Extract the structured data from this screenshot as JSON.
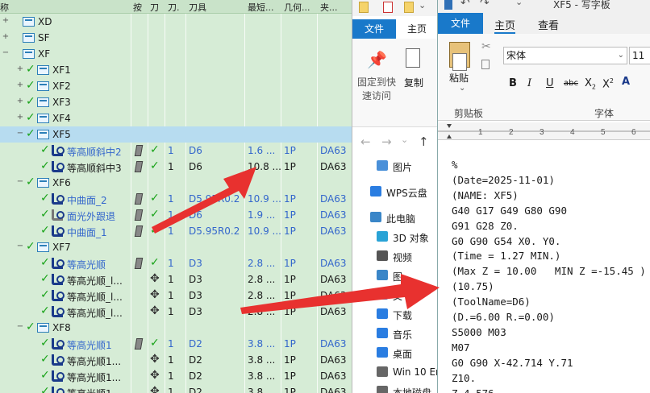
{
  "tree": {
    "columns": [
      "称",
      "按",
      "刀",
      "刀.",
      "刀具",
      "最短...",
      "几何...",
      "夹..."
    ],
    "rows": [
      {
        "level": 0,
        "expand": "+",
        "check": false,
        "icon": "folder",
        "label": "XD",
        "blue": false,
        "cells": []
      },
      {
        "level": 0,
        "expand": "+",
        "check": false,
        "icon": "folder",
        "label": "SF",
        "blue": false,
        "cells": []
      },
      {
        "level": 0,
        "expand": "−",
        "check": false,
        "icon": "folder",
        "label": "XF",
        "blue": false,
        "cells": []
      },
      {
        "level": 1,
        "expand": "+",
        "check": true,
        "icon": "folder",
        "label": "XF1",
        "blue": false,
        "cells": []
      },
      {
        "level": 1,
        "expand": "+",
        "check": true,
        "icon": "folder",
        "label": "XF2",
        "blue": false,
        "cells": []
      },
      {
        "level": 1,
        "expand": "+",
        "check": true,
        "icon": "folder",
        "label": "XF3",
        "blue": false,
        "cells": []
      },
      {
        "level": 1,
        "expand": "+",
        "check": true,
        "icon": "folder",
        "label": "XF4",
        "blue": false,
        "cells": []
      },
      {
        "level": 1,
        "expand": "−",
        "check": true,
        "icon": "folder",
        "label": "XF5",
        "blue": false,
        "selected": true,
        "cells": []
      },
      {
        "level": 2,
        "expand": "",
        "check": true,
        "icon": "tool",
        "label": "等高顺斜中2",
        "blue": true,
        "pen": true,
        "gchk": true,
        "move": false,
        "cells": [
          "1",
          "D6",
          "1.6 ...",
          "1P",
          "DA63"
        ],
        "cblue": true
      },
      {
        "level": 2,
        "expand": "",
        "check": true,
        "icon": "tool",
        "label": "等高顺斜中3",
        "blue": false,
        "pen": true,
        "gchk": true,
        "move": false,
        "cells": [
          "1",
          "D6",
          "10.8 ...",
          "1P",
          "DA63"
        ],
        "cblue": false
      },
      {
        "level": 1,
        "expand": "−",
        "check": true,
        "icon": "folder",
        "label": "XF6",
        "blue": false,
        "cells": []
      },
      {
        "level": 2,
        "expand": "",
        "check": true,
        "icon": "tool",
        "label": "中曲面_2",
        "blue": true,
        "pen": true,
        "gchk": true,
        "move": false,
        "cells": [
          "1",
          "D5.95R0.2",
          "10.9 ...",
          "1P",
          "DA63"
        ],
        "cblue": true
      },
      {
        "level": 2,
        "expand": "",
        "check": true,
        "icon": "tool2",
        "label": "面光外跟退",
        "blue": true,
        "pen": true,
        "gchk": true,
        "move": false,
        "cells": [
          "1",
          "D6",
          "1.9 ...",
          "1P",
          "DA63"
        ],
        "cblue": true
      },
      {
        "level": 2,
        "expand": "",
        "check": true,
        "icon": "tool",
        "label": "中曲面_1",
        "blue": true,
        "pen": true,
        "gchk": true,
        "move": false,
        "cells": [
          "1",
          "D5.95R0.2",
          "10.9 ...",
          "1P",
          "DA63"
        ],
        "cblue": true
      },
      {
        "level": 1,
        "expand": "−",
        "check": true,
        "icon": "folder",
        "label": "XF7",
        "blue": false,
        "cells": []
      },
      {
        "level": 2,
        "expand": "",
        "check": true,
        "icon": "tool",
        "label": "等高光顺",
        "blue": true,
        "pen": true,
        "gchk": true,
        "move": false,
        "cells": [
          "1",
          "D3",
          "2.8 ...",
          "1P",
          "DA63"
        ],
        "cblue": true
      },
      {
        "level": 2,
        "expand": "",
        "check": true,
        "icon": "tool",
        "label": "等高光顺_l...",
        "blue": false,
        "pen": false,
        "gchk": false,
        "move": true,
        "cells": [
          "1",
          "D3",
          "2.8 ...",
          "1P",
          "DA63"
        ],
        "cblue": false
      },
      {
        "level": 2,
        "expand": "",
        "check": true,
        "icon": "tool",
        "label": "等高光顺_l...",
        "blue": false,
        "pen": false,
        "gchk": false,
        "move": true,
        "cells": [
          "1",
          "D3",
          "2.8 ...",
          "1P",
          "DA63"
        ],
        "cblue": false
      },
      {
        "level": 2,
        "expand": "",
        "check": true,
        "icon": "tool",
        "label": "等高光顺_l...",
        "blue": false,
        "pen": false,
        "gchk": false,
        "move": true,
        "cells": [
          "1",
          "D3",
          "2.8 ...",
          "1P",
          "DA63"
        ],
        "cblue": false
      },
      {
        "level": 1,
        "expand": "−",
        "check": true,
        "icon": "folder",
        "label": "XF8",
        "blue": false,
        "cells": []
      },
      {
        "level": 2,
        "expand": "",
        "check": true,
        "icon": "tool",
        "label": "等高光顺1",
        "blue": true,
        "pen": true,
        "gchk": true,
        "move": false,
        "cells": [
          "1",
          "D2",
          "3.8 ...",
          "1P",
          "DA63"
        ],
        "cblue": true
      },
      {
        "level": 2,
        "expand": "",
        "check": true,
        "icon": "tool",
        "label": "等高光顺1...",
        "blue": false,
        "pen": false,
        "gchk": false,
        "move": true,
        "cells": [
          "1",
          "D2",
          "3.8 ...",
          "1P",
          "DA63"
        ],
        "cblue": false
      },
      {
        "level": 2,
        "expand": "",
        "check": true,
        "icon": "tool",
        "label": "等高光顺1...",
        "blue": false,
        "pen": false,
        "gchk": false,
        "move": true,
        "cells": [
          "1",
          "D2",
          "3.8 ...",
          "1P",
          "DA63"
        ],
        "cblue": false
      },
      {
        "level": 2,
        "expand": "",
        "check": true,
        "icon": "tool",
        "label": "等高光顺1",
        "blue": false,
        "pen": false,
        "gchk": false,
        "move": true,
        "cells": [
          "1",
          "D2",
          "3.8 ...",
          "1P",
          "DA63"
        ],
        "cblue": false
      }
    ]
  },
  "explorer": {
    "file_tab": "文件",
    "home_tab": "主页",
    "pin_label_1": "固定到快",
    "pin_label_2": "速访问",
    "copy_label": "复制",
    "sidebar": [
      {
        "label": "图片",
        "icon": "pictures-icon",
        "color": "#4a90d9"
      },
      {
        "label": "WPS云盘",
        "icon": "cloud-icon",
        "color": "#2a7de1"
      },
      {
        "label": "此电脑",
        "icon": "pc-icon",
        "color": "#3a86c8"
      },
      {
        "label": "3D 对象",
        "icon": "cube-icon",
        "color": "#29a3d6"
      },
      {
        "label": "视频",
        "icon": "video-icon",
        "color": "#555555"
      },
      {
        "label": "图",
        "icon": "image-icon",
        "color": "#3a86c8"
      },
      {
        "label": "文",
        "icon": "doc-icon",
        "color": "#3a86c8"
      },
      {
        "label": "下载",
        "icon": "download-icon",
        "color": "#2a7de1"
      },
      {
        "label": "音乐",
        "icon": "music-icon",
        "color": "#2a7de1"
      },
      {
        "label": "桌面",
        "icon": "desktop-icon",
        "color": "#2a7de1"
      },
      {
        "label": "Win 10 Ent",
        "icon": "drive-icon",
        "color": "#666666"
      },
      {
        "label": "本地磁盘",
        "icon": "drive-icon",
        "color": "#666666"
      }
    ]
  },
  "notepad": {
    "title": "XF5 - 写字板",
    "file_tab": "文件",
    "tabs": [
      "主页",
      "查看"
    ],
    "paste_label": "粘贴",
    "clipboard_label": "剪贴板",
    "font_label": "字体",
    "font_name": "宋体",
    "font_size": "11",
    "lines": [
      "%",
      "(Date=2025-11-01)",
      "(NAME: XF5)",
      "G40 G17 G49 G80 G90",
      "G91 G28 Z0.",
      "G0 G90 G54 X0. Y0.",
      "(Time = 1.27 MIN.)",
      "(Max Z = 10.00   MIN Z =-15.45 )",
      "(10.75)",
      "(ToolName=D6)",
      "(D.=6.00 R.=0.00)",
      "S5000 M03",
      "M07",
      "G0 G90 X-42.714 Y.71",
      "Z10.",
      "Z 4.576"
    ]
  },
  "colors": {
    "tree_bg": "#d6ecd6",
    "selected_row": "#b7dcf0",
    "accent_blue": "#1979ca",
    "arrow_red": "#e8312f",
    "check_green": "#19a319"
  }
}
